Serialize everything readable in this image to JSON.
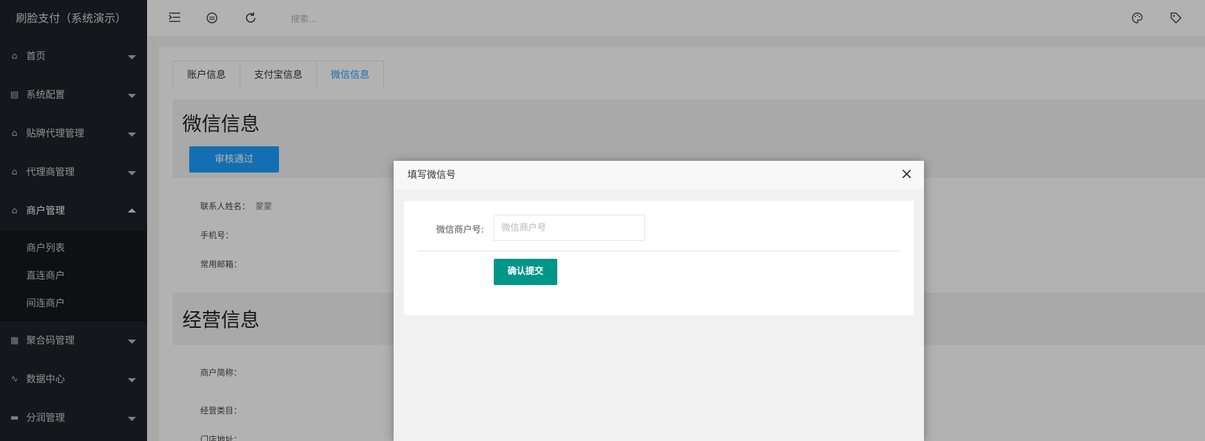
{
  "app": {
    "title": "刷脸支付（系统演示）"
  },
  "sidebar": {
    "items": [
      {
        "label": "首页",
        "icon": "home-icon"
      },
      {
        "label": "系统配置",
        "icon": "settings-icon"
      },
      {
        "label": "贴牌代理管理",
        "icon": "home-icon"
      },
      {
        "label": "代理商管理",
        "icon": "home-icon"
      },
      {
        "label": "商户管理",
        "icon": "home-icon",
        "open": true,
        "children": [
          "商户列表",
          "直连商户",
          "间连商户"
        ]
      },
      {
        "label": "聚合码管理",
        "icon": "apps-icon"
      },
      {
        "label": "数据中心",
        "icon": "chart-icon"
      },
      {
        "label": "分润管理",
        "icon": "monitor-icon"
      }
    ]
  },
  "header": {
    "search_placeholder": "搜索..."
  },
  "tabs": [
    "账户信息",
    "支付宝信息",
    "微信信息"
  ],
  "active_tab": "微信信息",
  "wechat_section": {
    "title": "微信信息",
    "approve_label": "审核通过",
    "contact_name_label": "联系人姓名：",
    "contact_name_value": "蒙蒙",
    "phone_label": "手机号：",
    "email_label": "常用邮箱："
  },
  "business_section": {
    "title": "经营信息",
    "short_name_label": "商户简称：",
    "category_label": "经营类目：",
    "address_label": "门店地址："
  },
  "modal": {
    "title": "填写微信号",
    "close_symbol": "×",
    "field_label": "微信商户号:",
    "field_placeholder": "微信商户号",
    "submit_label": "确认提交"
  },
  "colors": {
    "sidebar_bg": "#20222a",
    "accent_blue": "#1e9fff",
    "submit_green": "#009688"
  }
}
